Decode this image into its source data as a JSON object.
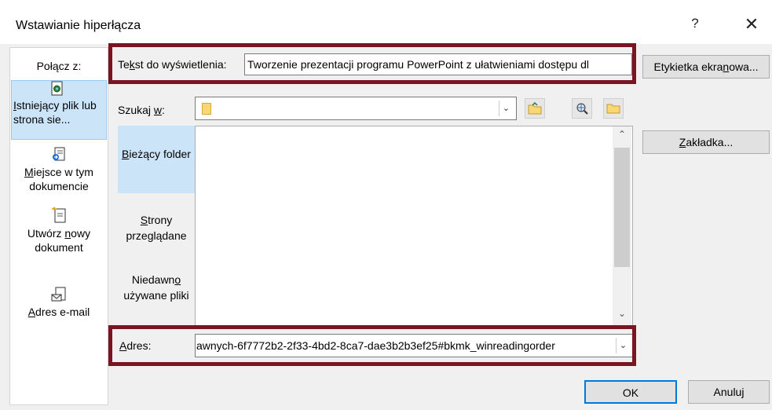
{
  "dialog": {
    "title": "Wstawianie hiperłącza",
    "help_glyph": "?",
    "close_glyph": "✕"
  },
  "link_to": {
    "label": "Połącz z:",
    "items": [
      {
        "label_u": "I",
        "label_rest": "stniejący plik lub strona sie...",
        "icon": "existing-file-icon",
        "selected": true
      },
      {
        "label_u": "M",
        "label_rest": "iejsce w tym dokumencie",
        "icon": "place-in-document-icon",
        "selected": false
      },
      {
        "label_pre": "Utwórz ",
        "label_u": "n",
        "label_rest": "owy dokument",
        "icon": "new-document-icon",
        "selected": false
      },
      {
        "label_u": "A",
        "label_rest": "dres e-mail",
        "icon": "email-address-icon",
        "selected": false
      }
    ]
  },
  "display_text": {
    "label_pre": "Te",
    "label_u": "k",
    "label_rest": "st do wyświetlenia:",
    "value": "Tworzenie prezentacji programu PowerPoint z ułatwieniami dostępu dl"
  },
  "screen_tip": {
    "pre": "Etykietka ekra",
    "u": "n",
    "rest": "owa..."
  },
  "look_in": {
    "pre": "Szukaj ",
    "u": "w",
    "rest": ":",
    "value": ""
  },
  "browse": {
    "current": {
      "u": "B",
      "rest": "ieżący folder"
    },
    "pages": {
      "u": "S",
      "rest": "trony przeglądane"
    },
    "recent": {
      "pre": "Niedawn",
      "u": "o",
      "rest": " używane pliki"
    }
  },
  "bookmark": {
    "u": "Z",
    "rest": "akładka..."
  },
  "address": {
    "label_u": "A",
    "label_rest": "dres:",
    "value": "awnych-6f7772b2-2f33-4bd2-8ca7-dae3b2b3ef25#bkmk_winreadingorder"
  },
  "buttons": {
    "ok": "OK",
    "cancel": "Anuluj"
  },
  "colors": {
    "highlight_border": "#7b1422",
    "selection": "#cce4f7",
    "default_button_border": "#0078d7"
  }
}
